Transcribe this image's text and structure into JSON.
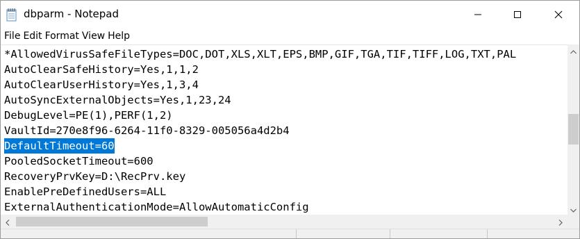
{
  "window": {
    "title": "dbparm - Notepad"
  },
  "menu": {
    "items": [
      "File",
      "Edit",
      "Format",
      "View",
      "Help"
    ]
  },
  "editor": {
    "lines": [
      "*AllowedVirusSafeFileTypes=DOC,DOT,XLS,XLT,EPS,BMP,GIF,TGA,TIF,TIFF,LOG,TXT,PAL",
      "AutoClearSafeHistory=Yes,1,1,2",
      "AutoClearUserHistory=Yes,1,3,4",
      "AutoSyncExternalObjects=Yes,1,23,24",
      "DebugLevel=PE(1),PERF(1,2)",
      "VaultId=270e8f96-6264-11f0-8329-005056a4d2b4",
      "DefaultTimeout=60",
      "PooledSocketTimeout=600",
      "RecoveryPrvKey=D:\\RecPrv.key",
      "EnablePreDefinedUsers=ALL",
      "ExternalAuthenticationMode=AllowAutomaticConfig"
    ],
    "selected_line_index": 6
  },
  "icons": {
    "app": "notepad-icon",
    "minimize": "minimize-icon",
    "maximize": "maximize-icon",
    "close": "close-icon"
  },
  "colors": {
    "selection": "#0078d7",
    "scrollbar_track": "#f0f0f0",
    "scrollbar_thumb": "#cdcdcd"
  }
}
